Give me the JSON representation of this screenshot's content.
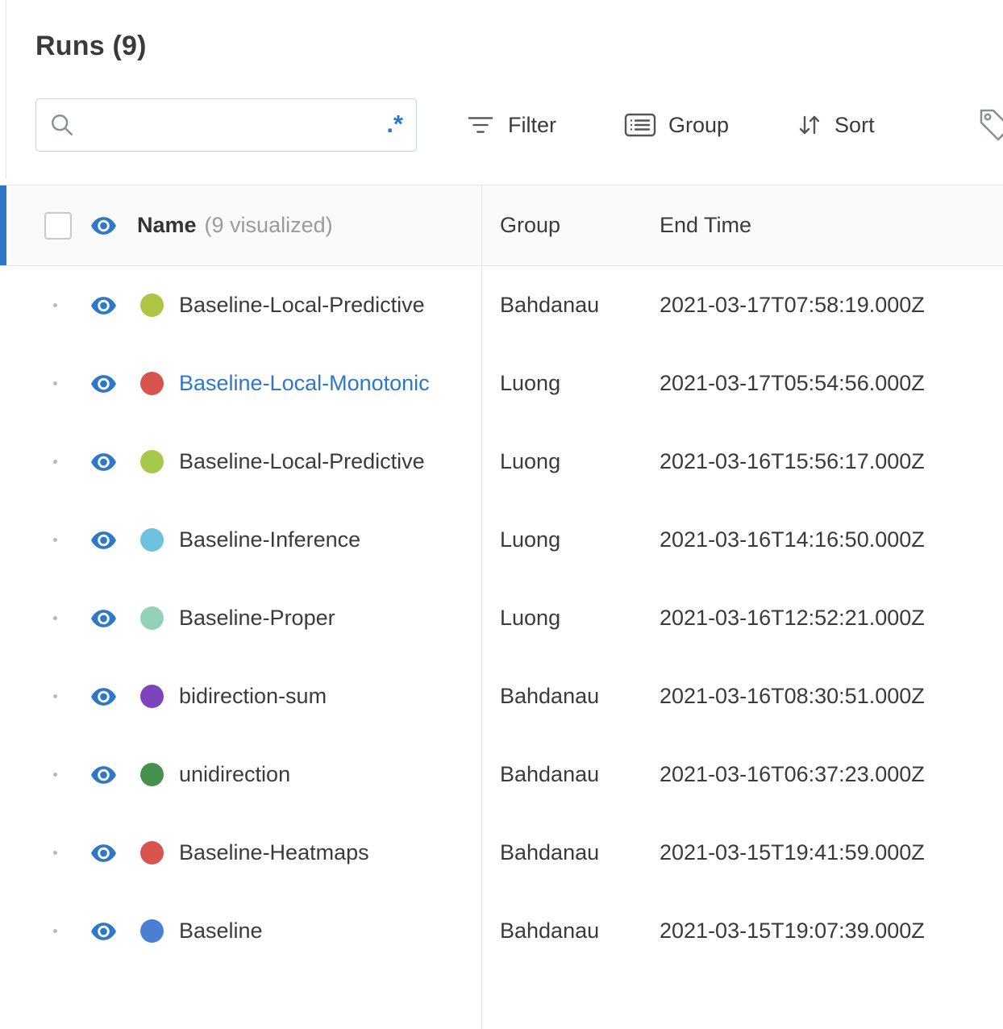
{
  "header": {
    "title": "Runs (9)"
  },
  "search": {
    "value": "",
    "placeholder": "",
    "regex_label": ".*"
  },
  "toolbar": {
    "filter_label": "Filter",
    "group_label": "Group",
    "sort_label": "Sort"
  },
  "icons": {
    "search": "magnifier",
    "regex": "dot-star-regex",
    "filter": "funnel-lines",
    "group": "list-box",
    "sort": "down-up-arrows",
    "tag": "price-tag",
    "visibility": "eye"
  },
  "table": {
    "columns": {
      "name": "Name",
      "name_suffix": "(9 visualized)",
      "group": "Group",
      "end_time": "End Time"
    },
    "rows": [
      {
        "name": "Baseline-Local-Predictive",
        "color": "#aec445",
        "group": "Bahdanau",
        "end_time": "2021-03-17T07:58:19.000Z",
        "link": false
      },
      {
        "name": "Baseline-Local-Monotonic",
        "color": "#d9534f",
        "group": "Luong",
        "end_time": "2021-03-17T05:54:56.000Z",
        "link": true
      },
      {
        "name": "Baseline-Local-Predictive",
        "color": "#a6c84d",
        "group": "Luong",
        "end_time": "2021-03-16T15:56:17.000Z",
        "link": false
      },
      {
        "name": "Baseline-Inference",
        "color": "#6ec2e0",
        "group": "Luong",
        "end_time": "2021-03-16T14:16:50.000Z",
        "link": false
      },
      {
        "name": "Baseline-Proper",
        "color": "#93d2b9",
        "group": "Luong",
        "end_time": "2021-03-16T12:52:21.000Z",
        "link": false
      },
      {
        "name": "bidirection-sum",
        "color": "#7d44bb",
        "group": "Bahdanau",
        "end_time": "2021-03-16T08:30:51.000Z",
        "link": false
      },
      {
        "name": "unidirection",
        "color": "#469150",
        "group": "Bahdanau",
        "end_time": "2021-03-16T06:37:23.000Z",
        "link": false
      },
      {
        "name": "Baseline-Heatmaps",
        "color": "#d9534f",
        "group": "Bahdanau",
        "end_time": "2021-03-15T19:41:59.000Z",
        "link": false
      },
      {
        "name": "Baseline",
        "color": "#4a7fd4",
        "group": "Bahdanau",
        "end_time": "2021-03-15T19:07:39.000Z",
        "link": false
      }
    ]
  },
  "colors": {
    "accent_blue": "#2e78c7",
    "link_blue": "#2e78c7",
    "divider": "#e3e3e3"
  }
}
